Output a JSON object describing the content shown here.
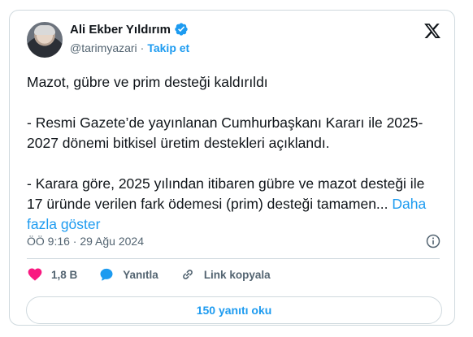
{
  "author": {
    "name": "Ali Ekber Yıldırım",
    "handle": "@tarimyazari",
    "separator": "·",
    "follow_label": "Takip et"
  },
  "tweet": {
    "text": "Mazot, gübre ve prim desteği kaldırıldı\n\n- Resmi Gazete’de yayınlanan Cumhurbaşkanı Kararı ile 2025- 2027 dönemi bitkisel üretim destekleri açıklandı.\n\n- Karara göre, 2025 yılından itibaren gübre ve mazot desteği ile 17 üründe verilen fark ödemesi (prim) desteği tamamen...",
    "more_label": " Daha fazla göster",
    "timestamp": "ÖÖ 9:16 · 29 Ağu 2024"
  },
  "actions": {
    "like_count": "1,8 B",
    "reply_label": "Yanıtla",
    "copy_link_label": "Link kopyala"
  },
  "replies_button_label": "150 yanıtı oku",
  "colors": {
    "accent": "#1d9bf0",
    "like": "#f91880",
    "muted": "#536471",
    "border": "#cfd9de"
  },
  "icons": [
    "verified-badge-icon",
    "x-logo-icon",
    "info-icon",
    "heart-icon",
    "reply-icon",
    "link-icon"
  ]
}
